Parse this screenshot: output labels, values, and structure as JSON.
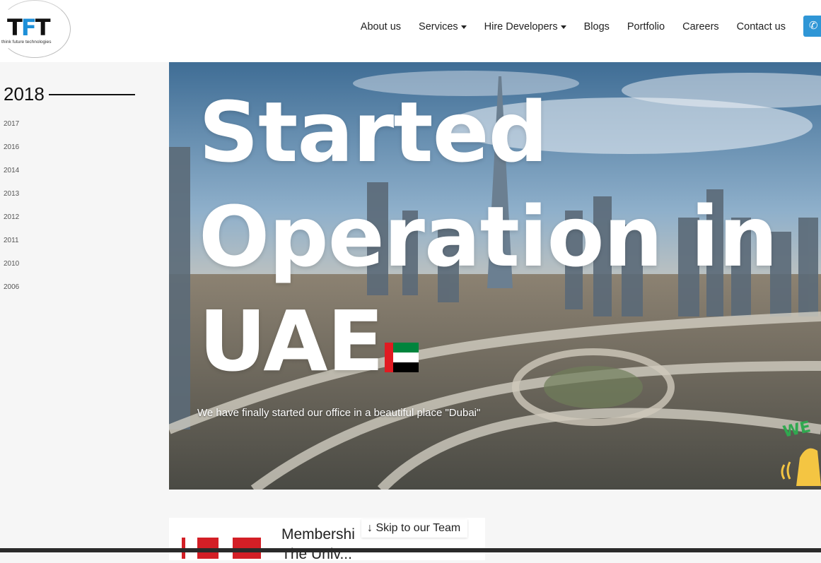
{
  "brand": {
    "logo_text_left": "T",
    "logo_text_mid": "F",
    "logo_text_right": "T",
    "tagline": "think future technologies",
    "accent": "#1d8fd8"
  },
  "nav": {
    "items": [
      {
        "label": "About us",
        "dropdown": false
      },
      {
        "label": "Services",
        "dropdown": true
      },
      {
        "label": "Hire Developers",
        "dropdown": true
      },
      {
        "label": "Blogs",
        "dropdown": false
      },
      {
        "label": "Portfolio",
        "dropdown": false
      },
      {
        "label": "Careers",
        "dropdown": false
      },
      {
        "label": "Contact us",
        "dropdown": false
      }
    ],
    "phone_icon": "phone-icon",
    "phone_color": "#2f96d6"
  },
  "timeline": {
    "active": "2018",
    "years": [
      "2017",
      "2016",
      "2014",
      "2013",
      "2012",
      "2011",
      "2010",
      "2006"
    ]
  },
  "hero": {
    "title_line1": "Started",
    "title_line2": "Operation in",
    "title_line3": "UAE",
    "flag_icon": "uae-flag-icon",
    "description": "We have finally started our office in a beautiful place \"Dubai\"",
    "badge_text": "WE"
  },
  "card": {
    "title": "Membershi",
    "subtitle": "The Univ..."
  },
  "skip_link": "↓ Skip to our Team"
}
